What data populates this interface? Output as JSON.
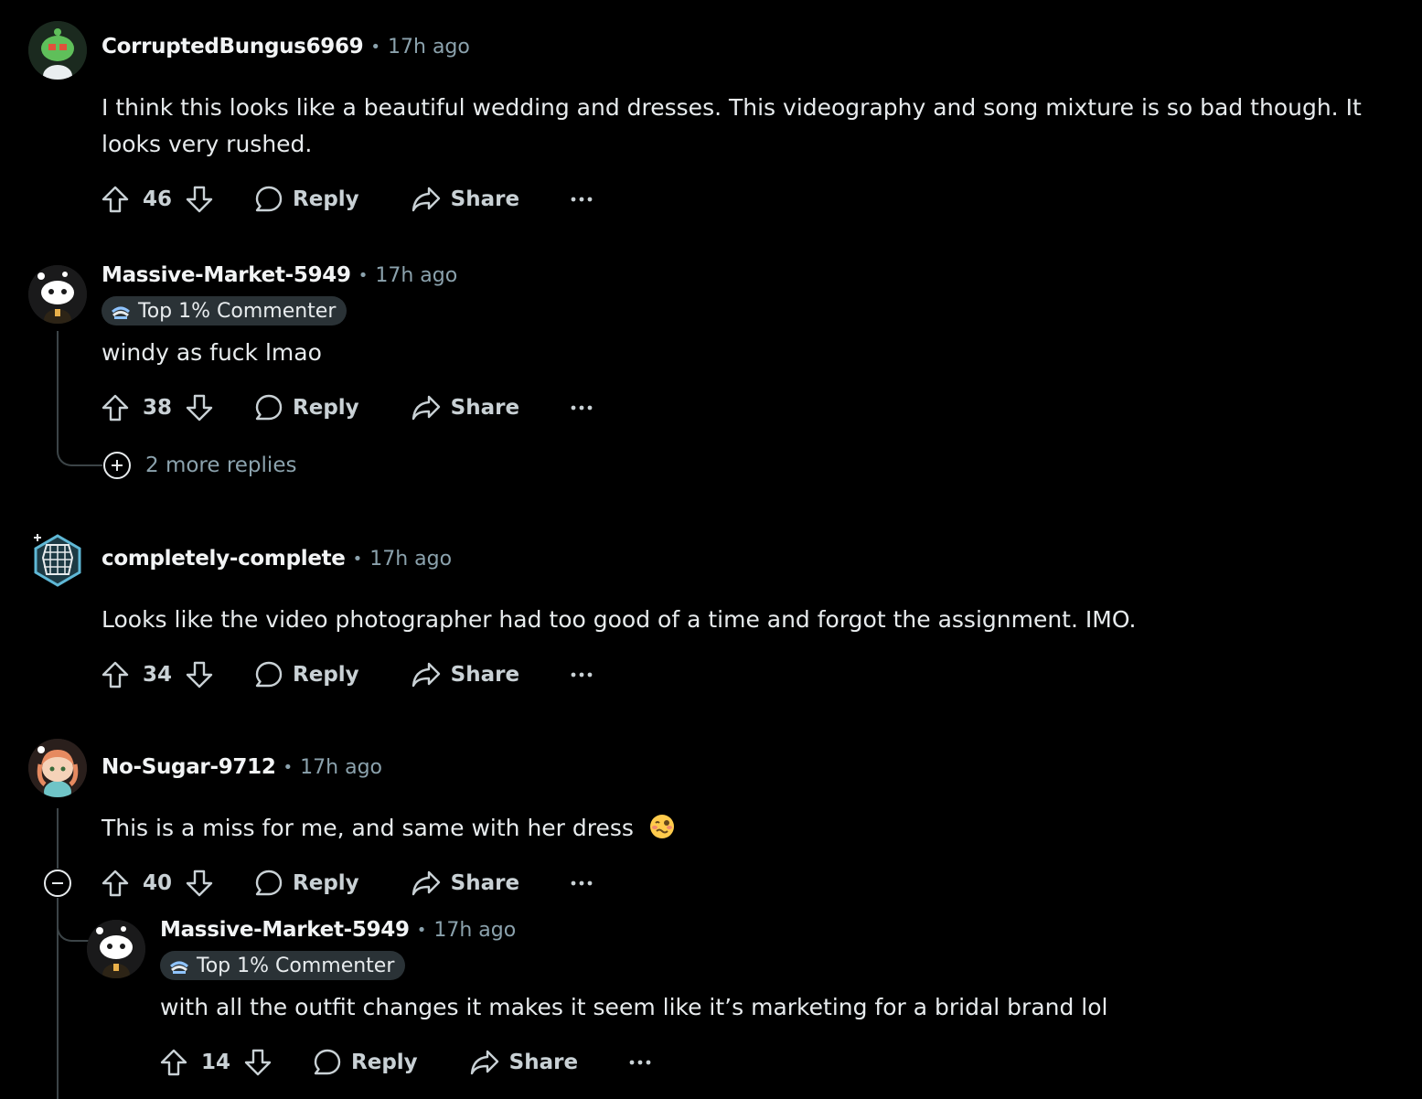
{
  "comments": [
    {
      "username": "CorruptedBungus6969",
      "time": "17h ago",
      "text": "I think this looks like a beautiful wedding and dresses. This videography and song mixture is so bad though. It looks very rushed.",
      "votes": "46",
      "reply_label": "Reply",
      "share_label": "Share"
    },
    {
      "username": "Massive-Market-5949",
      "time": "17h ago",
      "flair": "Top 1% Commenter",
      "text": "windy as fuck lmao",
      "votes": "38",
      "reply_label": "Reply",
      "share_label": "Share",
      "more_replies": "2 more replies"
    },
    {
      "username": "completely-complete",
      "time": "17h ago",
      "text": "Looks like the video photographer had too good of a time and forgot the assignment. IMO.",
      "votes": "34",
      "reply_label": "Reply",
      "share_label": "Share"
    },
    {
      "username": "No-Sugar-9712",
      "time": "17h ago",
      "text": "This is a miss for me, and same with her dress",
      "emoji": "woozy-face-emoji",
      "votes": "40",
      "reply_label": "Reply",
      "share_label": "Share"
    },
    {
      "username": "Massive-Market-5949",
      "time": "17h ago",
      "flair": "Top 1% Commenter",
      "text": "with all the outfit changes it makes it seem like it’s marketing for a bridal brand lol",
      "votes": "14",
      "reply_label": "Reply",
      "share_label": "Share"
    }
  ],
  "separator": "•",
  "colors": {
    "background": "#000000",
    "text": "#e7ebed",
    "muted": "#8ba2ad",
    "flair_bg": "#2a3236",
    "thread_line": "#3c4447"
  }
}
